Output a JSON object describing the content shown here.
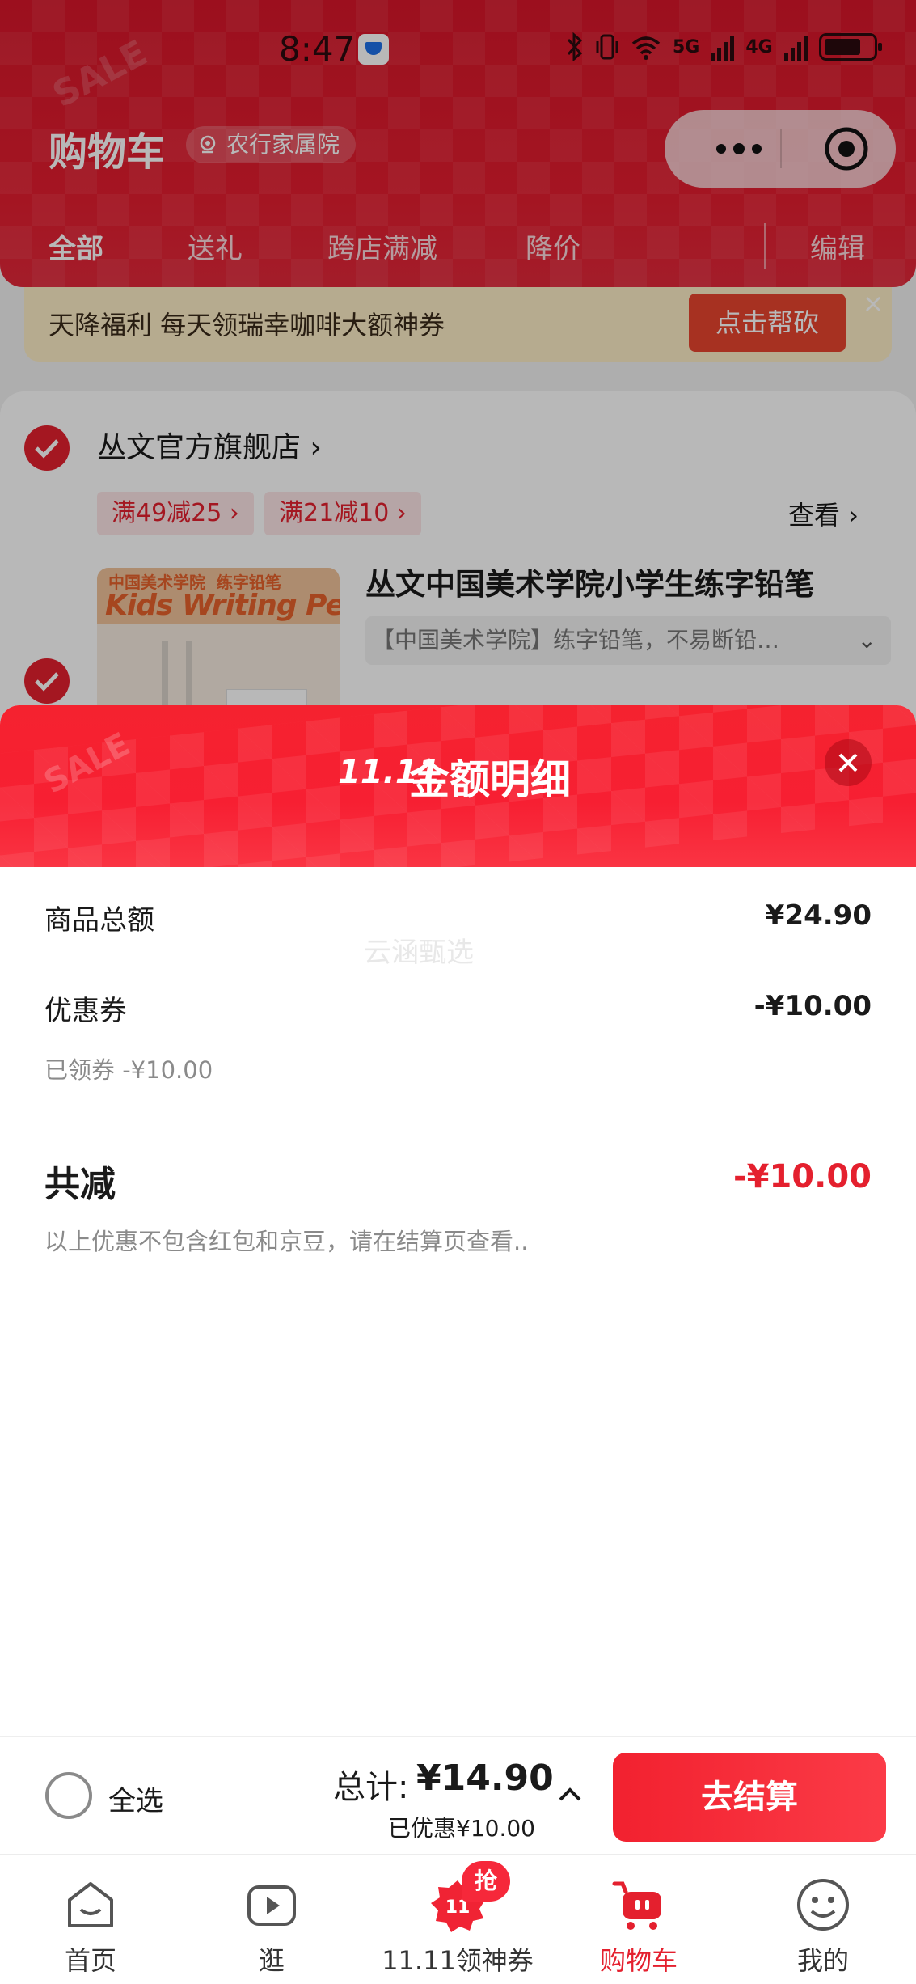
{
  "status_bar": {
    "time": "8:47",
    "net1": "5G",
    "net2": "4G"
  },
  "header": {
    "title": "购物车",
    "location": "农行家属院",
    "tabs": [
      "全部",
      "送礼",
      "跨店满减",
      "降价"
    ],
    "edit": "编辑"
  },
  "promo": {
    "text": "天降福利 每天领瑞幸咖啡大额神券",
    "button": "点击帮砍"
  },
  "store": {
    "name": "丛文官方旗舰店",
    "deals": [
      "满49减25",
      "满21减10"
    ],
    "view_label": "查看",
    "product": {
      "title": "丛文中国美术学院小学生练字铅笔",
      "spec": "【中国美术学院】练字铅笔，不易断铅…",
      "thumb_line1": "中国美术学院",
      "thumb_line1b": "练字铅笔",
      "thumb_line2": "Kids Writing Pencil"
    }
  },
  "sheet": {
    "logo": "11.11",
    "title": "金额明细",
    "watermark": "云涵甄选",
    "rows": {
      "goods_total_label": "商品总额",
      "goods_total_value": "¥24.90",
      "coupon_label": "优惠券",
      "coupon_value": "-¥10.00",
      "coupon_note": "已领券 -¥10.00",
      "total_discount_label": "共减",
      "total_discount_value": "-¥10.00",
      "disclaimer": "以上优惠不包含红包和京豆，请在结算页查看.."
    }
  },
  "checkout": {
    "select_all": "全选",
    "total_label": "总计:",
    "total_value": "¥14.90",
    "saved": "已优惠¥10.00",
    "pay_button": "去结算"
  },
  "bottom_nav": [
    {
      "label": "首页",
      "icon": "home-icon"
    },
    {
      "label": "逛",
      "icon": "video-play-icon"
    },
    {
      "label": "11.11领神券",
      "icon": "1111-coupon-icon",
      "badge": "抢"
    },
    {
      "label": "购物车",
      "icon": "cart-icon",
      "active": true
    },
    {
      "label": "我的",
      "icon": "smiley-profile-icon"
    }
  ],
  "colors": {
    "brand_red": "#e4202e",
    "header_red": "#d8162a",
    "promo_bg": "#fcedc7"
  }
}
